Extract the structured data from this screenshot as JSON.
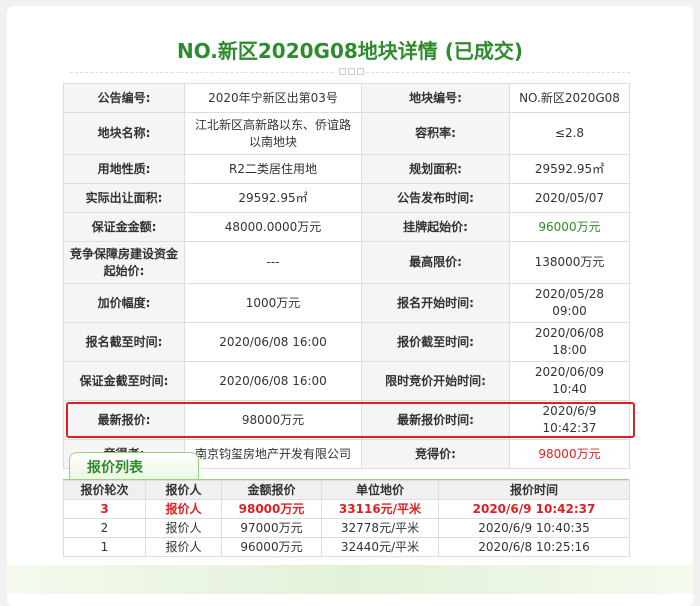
{
  "page": {
    "title": "NO.新区2020G08地块详情 (已成交)"
  },
  "info_rows": [
    {
      "label1": "公告编号:",
      "value1": "2020年宁新区出第03号",
      "label2": "地块编号:",
      "value2": "NO.新区2020G08"
    },
    {
      "label1": "地块名称:",
      "value1": "江北新区高新路以东、侨谊路以南地块",
      "label2": "容积率:",
      "value2": "≤2.8"
    },
    {
      "label1": "用地性质:",
      "value1": "R2二类居住用地",
      "label2": "规划面积:",
      "value2": "29592.95㎡"
    },
    {
      "label1": "实际出让面积:",
      "value1": "29592.95㎡",
      "label2": "公告发布时间:",
      "value2": "2020/05/07"
    },
    {
      "label1": "保证金金额:",
      "value1": "48000.0000万元",
      "label2": "挂牌起始价:",
      "value2": "96000万元"
    },
    {
      "label1": "竞争保障房建设资金起始价:",
      "value1": "---",
      "label2": "最高限价:",
      "value2": "138000万元"
    },
    {
      "label1": "加价幅度:",
      "value1": "1000万元",
      "label2": "报名开始时间:",
      "value2": "2020/05/28 09:00"
    },
    {
      "label1": "报名截至时间:",
      "value1": "2020/06/08 16:00",
      "label2": "报价截至时间:",
      "value2": "2020/06/08 18:00"
    },
    {
      "label1": "保证金截至时间:",
      "value1": "2020/06/08 16:00",
      "label2": "限时竞价开始时间:",
      "value2": "2020/06/09 10:40"
    },
    {
      "label1": "最新报价:",
      "value1": "98000万元",
      "label2": "最新报价时间:",
      "value2": "2020/6/9 10:42:37"
    },
    {
      "label1": "竞得者:",
      "value1": "南京钧玺房地产开发有限公司",
      "label2": "竞得价:",
      "value2": "98000万元"
    }
  ],
  "bids": {
    "tab_label": "报价列表",
    "headers": [
      "报价轮次",
      "报价人",
      "金额报价",
      "单位地价",
      "报价时间"
    ],
    "rows": [
      {
        "round": "3",
        "bidder": "报价人",
        "amount": "98000万元",
        "unit_price": "33116元/平米",
        "time": "2020/6/9 10:42:37"
      },
      {
        "round": "2",
        "bidder": "报价人",
        "amount": "97000万元",
        "unit_price": "32778元/平米",
        "time": "2020/6/9 10:40:35"
      },
      {
        "round": "1",
        "bidder": "报价人",
        "amount": "96000万元",
        "unit_price": "32440元/平米",
        "time": "2020/6/8 10:25:16"
      }
    ]
  },
  "colors": {
    "title_green": "#2e8b2e",
    "start_price_green": "#2e8b2e",
    "highlight_red": "#e02020"
  }
}
